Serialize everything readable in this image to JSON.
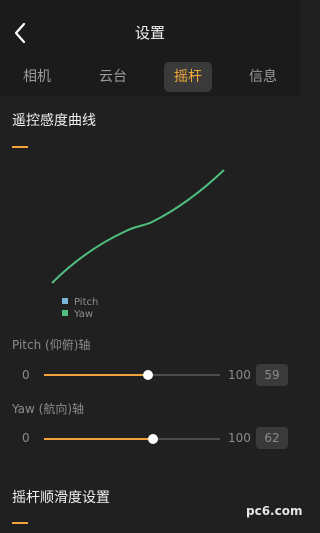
{
  "header": {
    "title": "设置"
  },
  "tabs": [
    {
      "label": "相机",
      "active": false
    },
    {
      "label": "云台",
      "active": false
    },
    {
      "label": "摇杆",
      "active": true
    },
    {
      "label": "信息",
      "active": false
    }
  ],
  "curve_section": {
    "title": "遥控感度曲线"
  },
  "legend": [
    {
      "label": "Pitch",
      "color": "#7ab6d9"
    },
    {
      "label": "Yaw",
      "color": "#4fbe7e"
    }
  ],
  "sliders": [
    {
      "label": "Pitch (仰俯)轴",
      "min": "0",
      "max": "100",
      "value": 59
    },
    {
      "label": "Yaw (航向)轴",
      "min": "0",
      "max": "100",
      "value": 62
    }
  ],
  "smooth_section": {
    "title": "摇杆顺滑度设置"
  },
  "watermark": {
    "text": "pc6.com"
  },
  "colors": {
    "accent": "#f2a43a",
    "curve": "#4fbe7e",
    "background": "#202020"
  }
}
